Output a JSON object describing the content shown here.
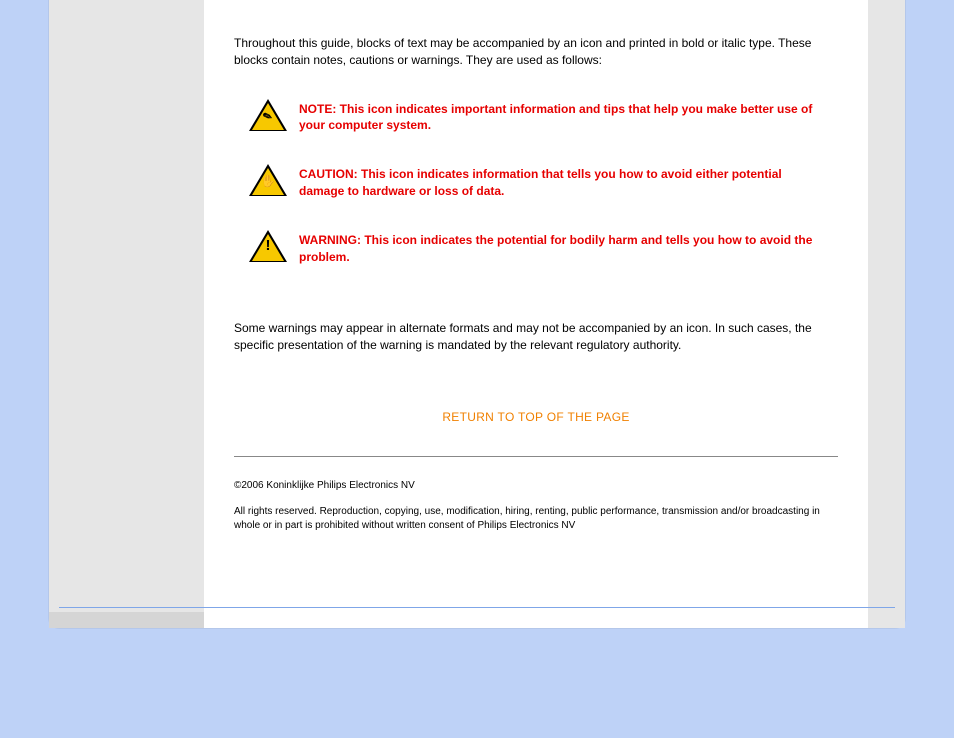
{
  "intro": "Throughout this guide, blocks of text may be accompanied by an icon and printed in bold or italic type. These blocks contain notes, cautions or warnings. They are used as follows:",
  "blocks": {
    "note": "NOTE: This icon indicates important information and tips that help you make better use of your computer system.",
    "caution": "CAUTION: This icon indicates information that tells you how to avoid either potential damage to hardware or loss of data.",
    "warning": "WARNING: This icon indicates the potential for bodily harm and tells you how to avoid the problem."
  },
  "outro": "Some warnings may appear in alternate formats and may not be accompanied by an icon. In such cases, the specific presentation of the warning is mandated by the relevant regulatory authority.",
  "return_link": "RETURN TO TOP OF THE PAGE",
  "copyright": "©2006 Koninklijke Philips Electronics NV",
  "rights": "All rights reserved. Reproduction, copying, use, modification, hiring, renting, public performance, transmission and/or broadcasting in whole or in part is prohibited without written consent of Philips Electronics NV"
}
